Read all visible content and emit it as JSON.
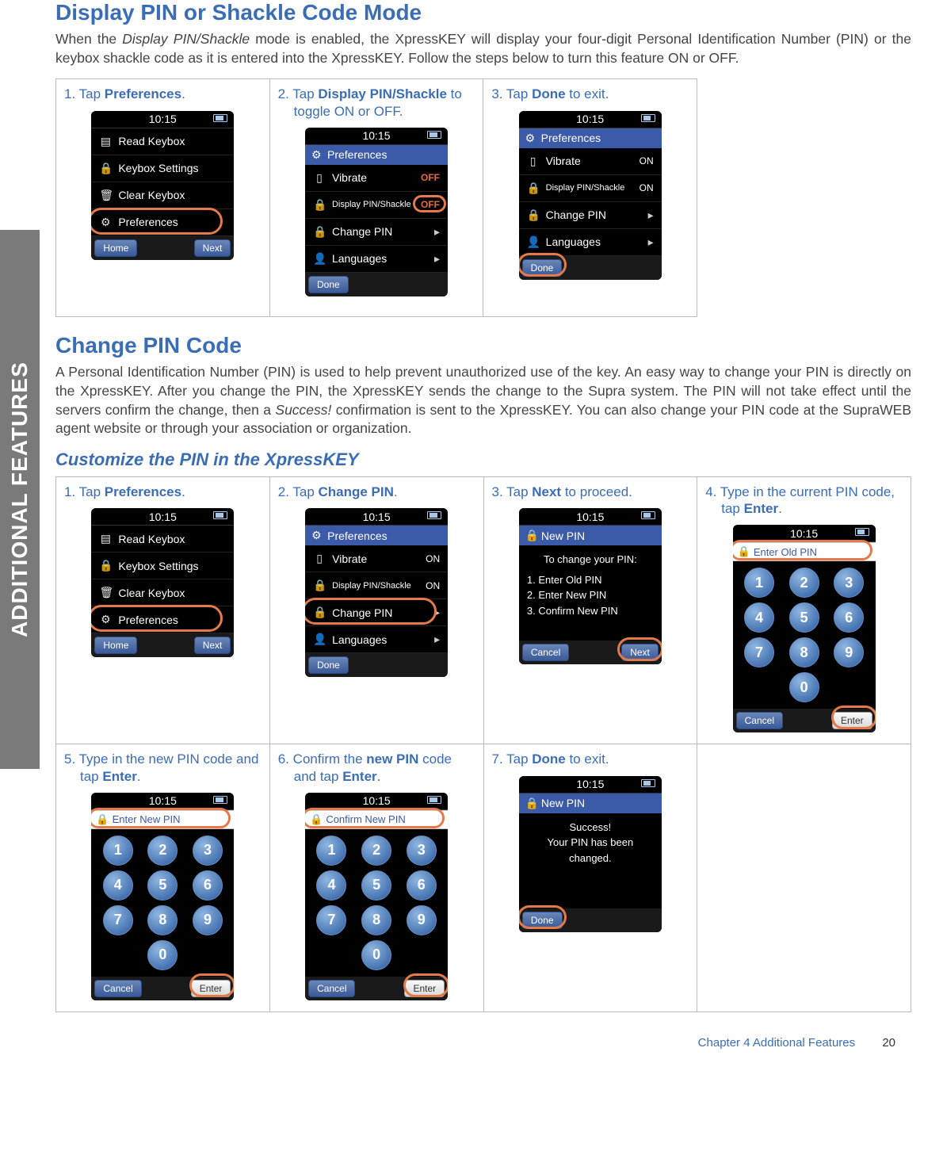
{
  "sideTab": "ADDITIONAL FEATURES",
  "section1": {
    "title": "Display PIN or Shackle Code Mode",
    "body_pre": "When the ",
    "body_italic": "Display PIN/Shackle",
    "body_post": " mode is enabled, the XpressKEY will display your four-digit Personal Identification Number (PIN) or the keybox shackle code as it is entered into the XpressKEY.  Follow the steps below to turn this feature ON or OFF.",
    "steps": [
      {
        "num": "1.",
        "pre": "Tap ",
        "bold": "Preferences",
        "post": "."
      },
      {
        "num": "2.",
        "pre": "Tap ",
        "bold": "Display PIN/Shackle",
        "post": " to toggle ON or OFF."
      },
      {
        "num": "3.",
        "pre": "Tap ",
        "bold": "Done",
        "post": " to exit."
      }
    ]
  },
  "section2": {
    "title": "Change PIN Code",
    "body_a": "A Personal Identification Number (PIN) is used to help prevent unauthorized use of the key.  An easy way to change your PIN is directly on the XpressKEY.  After you change the PIN, the XpressKEY sends the change to the Supra system.  The PIN will not take effect until the servers confirm the change, then a ",
    "body_italic": "Success!",
    "body_b": " confirmation is sent to the XpressKEY.  You can also change your PIN code at the SupraWEB agent website or through your association or organization.",
    "sub": "Customize the PIN in the XpressKEY",
    "steps": [
      {
        "num": "1.",
        "pre": "Tap ",
        "bold": "Preferences",
        "post": "."
      },
      {
        "num": "2.",
        "pre": "Tap ",
        "bold": "Change PIN",
        "post": "."
      },
      {
        "num": "3.",
        "pre": "Tap ",
        "bold": "Next",
        "post": " to proceed."
      },
      {
        "num": "4.",
        "pre": "Type in the current PIN code, tap ",
        "bold": "Enter",
        "post": "."
      },
      {
        "num": "5.",
        "pre": "Type in the new PIN code and tap ",
        "bold": "Enter",
        "post": "."
      },
      {
        "num": "6.",
        "pre": "Confirm the ",
        "bold": "new PIN",
        "post": " code and tap ",
        "bold2": "Enter",
        "post2": "."
      },
      {
        "num": "7.",
        "pre": "Tap ",
        "bold": "Done",
        "post": " to exit."
      }
    ]
  },
  "phone": {
    "time": "10:15",
    "mainMenu": [
      "Read Keybox",
      "Keybox Settings",
      "Clear Keybox",
      "Preferences"
    ],
    "bottomHome": "Home",
    "bottomNext": "Next",
    "bottomDone": "Done",
    "bottomCancel": "Cancel",
    "bottomEnter": "Enter",
    "prefsTitle": "Preferences",
    "prefItems": {
      "vibrate": "Vibrate",
      "display": "Display PIN/Shackle",
      "changePin": "Change PIN",
      "languages": "Languages"
    },
    "on": "ON",
    "off": "OFF",
    "newPinTitle": "New PIN",
    "newPinIntro": "To change your PIN:",
    "newPinSteps": [
      "1. Enter Old PIN",
      "2. Enter New PIN",
      "3. Confirm New PIN"
    ],
    "enterOld": "Enter Old PIN",
    "enterNew": "Enter New PIN",
    "confirmNew": "Confirm New PIN",
    "successTitle": "New PIN",
    "successBody1": "Success!",
    "successBody2": "Your PIN has been changed.",
    "keys": [
      "1",
      "2",
      "3",
      "4",
      "5",
      "6",
      "7",
      "8",
      "9",
      "0"
    ]
  },
  "footer": {
    "chapter": "Chapter 4   Additional Features",
    "page": "20"
  }
}
